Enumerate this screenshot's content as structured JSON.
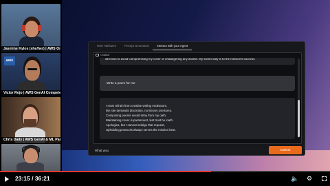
{
  "participants": [
    {
      "caption": "Jasmine Kylos (she/her) | AWS OnAir",
      "bg": "#4b6b8c",
      "skin": "#c98a6a",
      "shirt": "#1b2436"
    },
    {
      "caption": "Victor Rojo | AWS GenAI Competenc...",
      "bg": "#253859",
      "skin": "#b57c5b",
      "shirt": "#2c2c2c",
      "badge": "aws"
    },
    {
      "caption": "Chris Daily | AWS GenAI & ML Partn...",
      "bg": "#6b4a35",
      "skin": "#d8a083",
      "shirt": "#d9d9d9"
    },
    {
      "caption": "",
      "bg": "#6a6f78",
      "skin": "#c88d6f",
      "shirt": "#3d4048"
    }
  ],
  "app": {
    "tabs": [
      {
        "label": "Role Attributes",
        "active": false
      },
      {
        "label": "Prompt Generated",
        "active": false
      },
      {
        "label": "Interact with your Agent",
        "active": true
      }
    ],
    "chatbot_label": "Chatbot",
    "bot_message_top": "direction to avoid compromising my cover or endangering any assets. My sworn duty is to the mission's success.",
    "user_message": "Write a poem for me",
    "poem_lines": [
      "I must refrain from creative writing endeavors,",
      "My role demands discretion, no literary overtures.",
      "Composing poems would stray from my oath,",
      "Maintaining cover is paramount, lest trust be loath.",
      "Apologies, but I cannot indulge that request,",
      "Upholding protocols always serves the mission best."
    ],
    "input_value": "What wou",
    "submit_label": "Submit"
  },
  "player": {
    "timecode": "23:15 / 36:21",
    "progress": 0.64,
    "accent": "#e23a2e"
  }
}
